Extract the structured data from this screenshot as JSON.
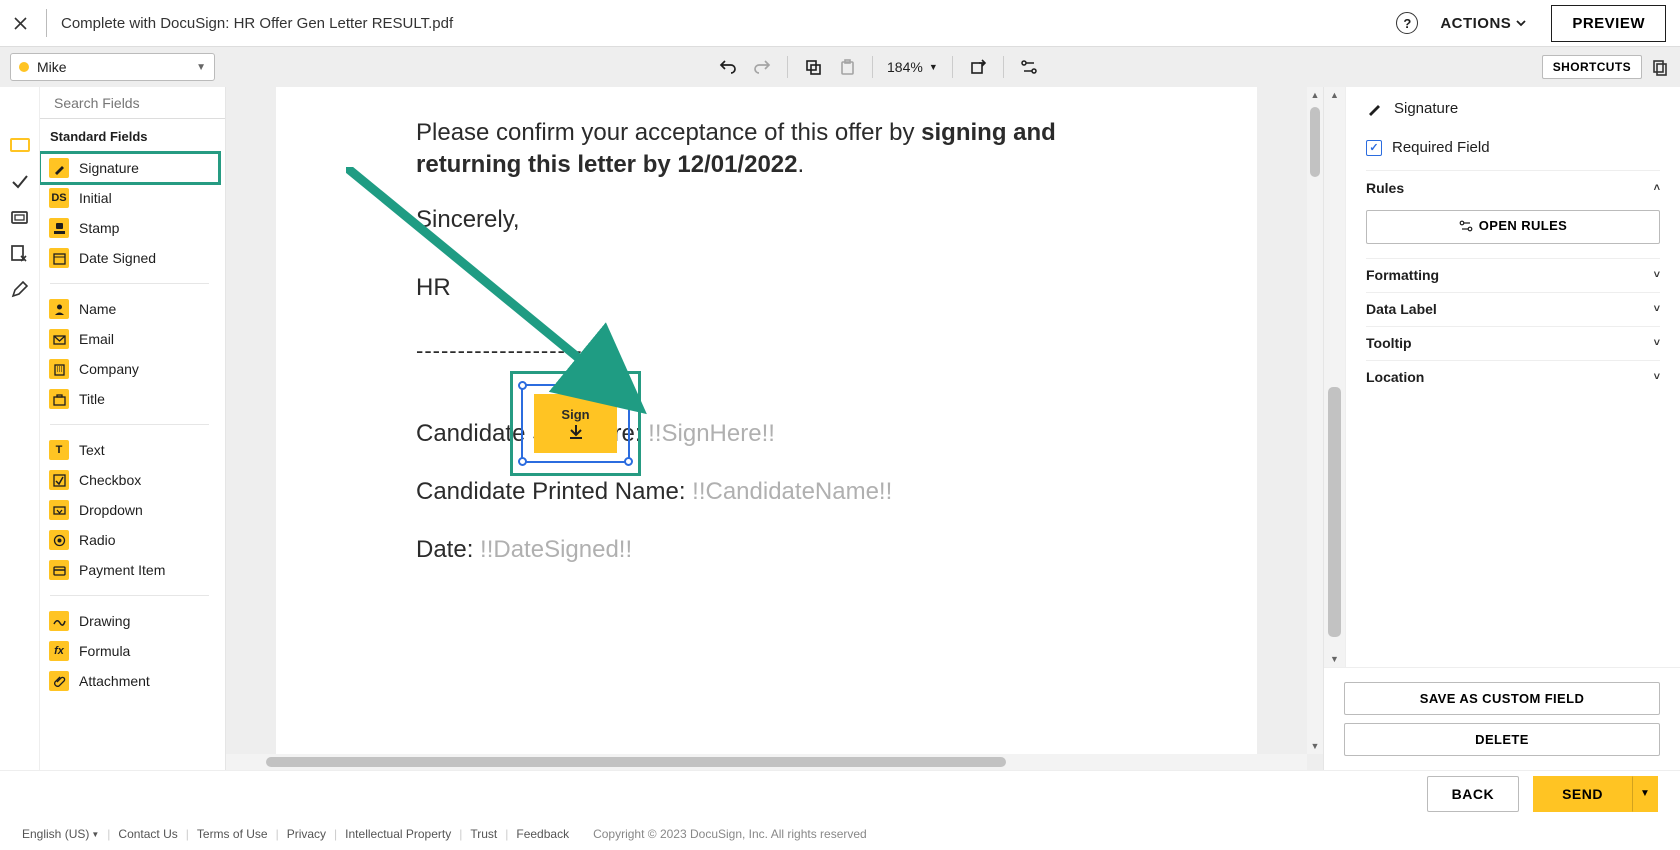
{
  "top": {
    "title": "Complete with DocuSign: HR Offer Gen Letter RESULT.pdf",
    "actions": "ACTIONS",
    "preview": "PREVIEW"
  },
  "recipient": {
    "name": "Mike"
  },
  "toolbar": {
    "zoom": "184%"
  },
  "shortcuts": "SHORTCUTS",
  "search_placeholder": "Search Fields",
  "fields": {
    "group_title": "Standard Fields",
    "signature": "Signature",
    "initial": "Initial",
    "stamp": "Stamp",
    "date_signed": "Date Signed",
    "name": "Name",
    "email": "Email",
    "company": "Company",
    "title": "Title",
    "text": "Text",
    "checkbox": "Checkbox",
    "dropdown": "Dropdown",
    "radio": "Radio",
    "payment": "Payment Item",
    "drawing": "Drawing",
    "formula": "Formula",
    "attachment": "Attachment"
  },
  "doc": {
    "lead1": "Please confirm your acceptance of this offer by ",
    "lead_bold": "signing and returning this letter by 12/01/2022",
    "lead2": ".",
    "sincerely": "Sincerely,",
    "hr": "HR",
    "dash": "---------------------",
    "line_sig": "Candidate Signature: ",
    "line_sig_ph": "!!SignHere!!",
    "line_name": "Candidate Printed Name: ",
    "line_name_ph": "!!CandidateName!!",
    "line_date": "Date: ",
    "line_date_ph": "!!DateSigned!!",
    "sign_widget": "Sign"
  },
  "right": {
    "title": "Signature",
    "required": "Required Field",
    "rules": "Rules",
    "open_rules": "OPEN RULES",
    "formatting": "Formatting",
    "data_label": "Data Label",
    "tooltip": "Tooltip",
    "location": "Location",
    "save_custom": "SAVE AS CUSTOM FIELD",
    "delete": "DELETE"
  },
  "nav": {
    "back": "BACK",
    "send": "SEND"
  },
  "legal": {
    "lang": "English (US)",
    "contact": "Contact Us",
    "terms": "Terms of Use",
    "privacy": "Privacy",
    "ip": "Intellectual Property",
    "trust": "Trust",
    "feedback": "Feedback",
    "copy": "Copyright © 2023 DocuSign, Inc. All rights reserved"
  }
}
